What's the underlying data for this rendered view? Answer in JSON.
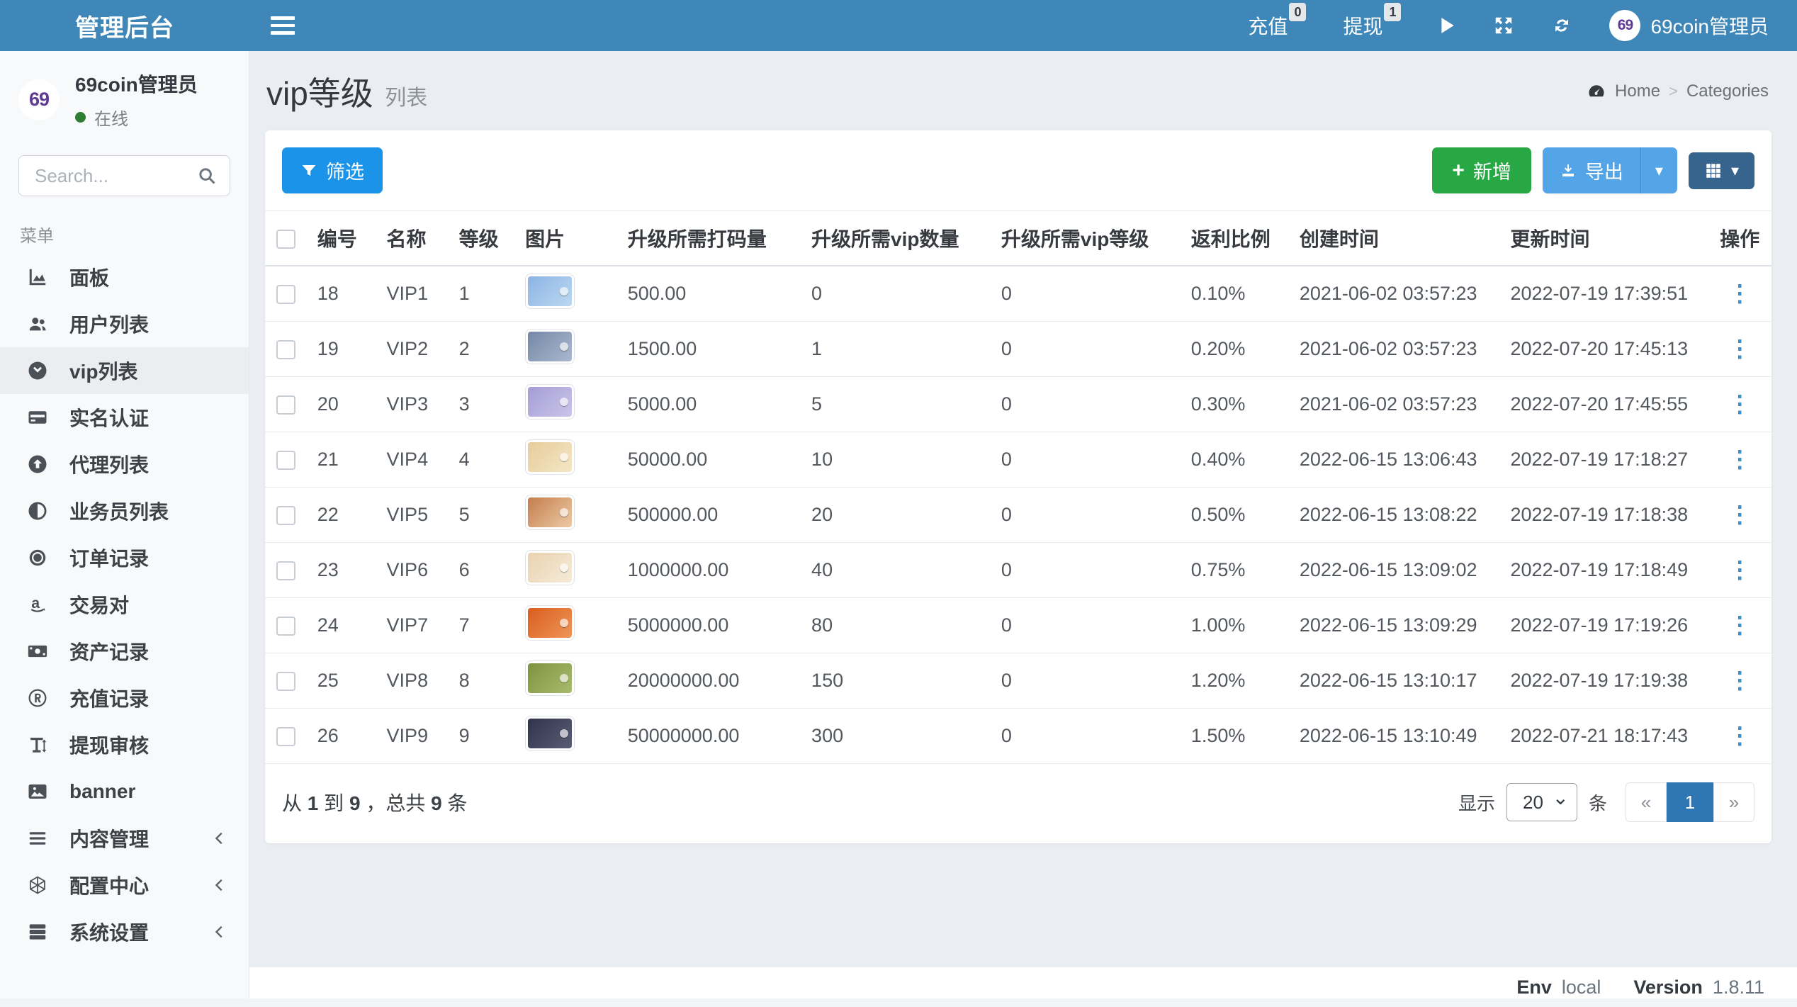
{
  "navbar": {
    "brand": "管理后台",
    "recharge": {
      "label": "充值",
      "badge": "0"
    },
    "withdraw": {
      "label": "提现",
      "badge": "1"
    },
    "user_name": "69coin管理员",
    "avatar_text": "69"
  },
  "sidebar": {
    "user": {
      "name": "69coin管理员",
      "avatar_text": "69",
      "status": "在线"
    },
    "search_placeholder": "Search...",
    "section_label": "菜单",
    "items": [
      {
        "icon": "chart-area-icon",
        "label": "面板"
      },
      {
        "icon": "users-icon",
        "label": "用户列表"
      },
      {
        "icon": "vip-circle-icon",
        "label": "vip列表",
        "active": true
      },
      {
        "icon": "id-card-icon",
        "label": "实名认证"
      },
      {
        "icon": "arrow-circle-up-icon",
        "label": "代理列表"
      },
      {
        "icon": "adjust-icon",
        "label": "业务员列表"
      },
      {
        "icon": "medal-icon",
        "label": "订单记录"
      },
      {
        "icon": "amazon-a-icon",
        "label": "交易对"
      },
      {
        "icon": "money-bill-icon",
        "label": "资产记录"
      },
      {
        "icon": "registered-icon",
        "label": "充值记录"
      },
      {
        "icon": "text-height-icon",
        "label": "提现审核"
      },
      {
        "icon": "image-icon",
        "label": "banner"
      },
      {
        "icon": "bars-icon",
        "label": "内容管理",
        "collapsible": true
      },
      {
        "icon": "hexagon-icon",
        "label": "配置中心",
        "collapsible": true
      },
      {
        "icon": "layers-icon",
        "label": "系统设置",
        "collapsible": true
      }
    ]
  },
  "page": {
    "title": "vip等级",
    "subtitle": "列表",
    "breadcrumb": {
      "home": "Home",
      "current": "Categories"
    }
  },
  "toolbar": {
    "filter_label": "筛选",
    "add_label": "新增",
    "export_label": "导出"
  },
  "table": {
    "headers": [
      "编号",
      "名称",
      "等级",
      "图片",
      "升级所需打码量",
      "升级所需vip数量",
      "升级所需vip等级",
      "返利比例",
      "创建时间",
      "更新时间",
      "操作"
    ],
    "rows": [
      {
        "id": "18",
        "name": "VIP1",
        "level": "1",
        "image_gradient": [
          "#8cb4e4",
          "#bcd8f0"
        ],
        "bet_amount": "500.00",
        "vip_count": "0",
        "vip_level": "0",
        "rebate": "0.10%",
        "created_at": "2021-06-02 03:57:23",
        "updated_at": "2022-07-19 17:39:51"
      },
      {
        "id": "19",
        "name": "VIP2",
        "level": "2",
        "image_gradient": [
          "#7688a8",
          "#aab8ce"
        ],
        "bet_amount": "1500.00",
        "vip_count": "1",
        "vip_level": "0",
        "rebate": "0.20%",
        "created_at": "2021-06-02 03:57:23",
        "updated_at": "2022-07-20 17:45:13"
      },
      {
        "id": "20",
        "name": "VIP3",
        "level": "3",
        "image_gradient": [
          "#a49dd6",
          "#cac5e8"
        ],
        "bet_amount": "5000.00",
        "vip_count": "5",
        "vip_level": "0",
        "rebate": "0.30%",
        "created_at": "2021-06-02 03:57:23",
        "updated_at": "2022-07-20 17:45:55"
      },
      {
        "id": "21",
        "name": "VIP4",
        "level": "4",
        "image_gradient": [
          "#e7cc9a",
          "#f4e7c6"
        ],
        "bet_amount": "50000.00",
        "vip_count": "10",
        "vip_level": "0",
        "rebate": "0.40%",
        "created_at": "2022-06-15 13:06:43",
        "updated_at": "2022-07-19 17:18:27"
      },
      {
        "id": "22",
        "name": "VIP5",
        "level": "5",
        "image_gradient": [
          "#c37d4c",
          "#edcaa5"
        ],
        "bet_amount": "500000.00",
        "vip_count": "20",
        "vip_level": "0",
        "rebate": "0.50%",
        "created_at": "2022-06-15 13:08:22",
        "updated_at": "2022-07-19 17:18:38"
      },
      {
        "id": "23",
        "name": "VIP6",
        "level": "6",
        "image_gradient": [
          "#e9d2b0",
          "#f6ebd8"
        ],
        "bet_amount": "1000000.00",
        "vip_count": "40",
        "vip_level": "0",
        "rebate": "0.75%",
        "created_at": "2022-06-15 13:09:02",
        "updated_at": "2022-07-19 17:18:49"
      },
      {
        "id": "24",
        "name": "VIP7",
        "level": "7",
        "image_gradient": [
          "#d95e1f",
          "#ee9558"
        ],
        "bet_amount": "5000000.00",
        "vip_count": "80",
        "vip_level": "0",
        "rebate": "1.00%",
        "created_at": "2022-06-15 13:09:29",
        "updated_at": "2022-07-19 17:19:26"
      },
      {
        "id": "25",
        "name": "VIP8",
        "level": "8",
        "image_gradient": [
          "#7e9440",
          "#a9ba6c"
        ],
        "bet_amount": "20000000.00",
        "vip_count": "150",
        "vip_level": "0",
        "rebate": "1.20%",
        "created_at": "2022-06-15 13:10:17",
        "updated_at": "2022-07-19 17:19:38"
      },
      {
        "id": "26",
        "name": "VIP9",
        "level": "9",
        "image_gradient": [
          "#32344c",
          "#595c74"
        ],
        "bet_amount": "50000000.00",
        "vip_count": "300",
        "vip_level": "0",
        "rebate": "1.50%",
        "created_at": "2022-06-15 13:10:49",
        "updated_at": "2022-07-21 18:17:43"
      }
    ]
  },
  "pagination": {
    "info": {
      "prefix": "从",
      "from": "1",
      "mid": "到",
      "to": "9",
      "total_label": "，总共",
      "total": "9",
      "unit": "条"
    },
    "show_label": "显示",
    "page_size_options": [
      "20"
    ],
    "page_size": "20",
    "unit_label": "条",
    "prev": "«",
    "page": "1",
    "next": "»"
  },
  "footer": {
    "env_label": "Env",
    "env_value": "local",
    "version_label": "Version",
    "version_value": "1.8.11"
  },
  "colors": {
    "navbar": "#3e87b8",
    "primary_button": "#1b93e8",
    "add_button": "#28a745",
    "export_button": "#54a5e8",
    "columns_button": "#37648c",
    "active_page": "#2f76b5",
    "logo_purple": "#5f3a94",
    "online_dot": "#2e7d32"
  }
}
